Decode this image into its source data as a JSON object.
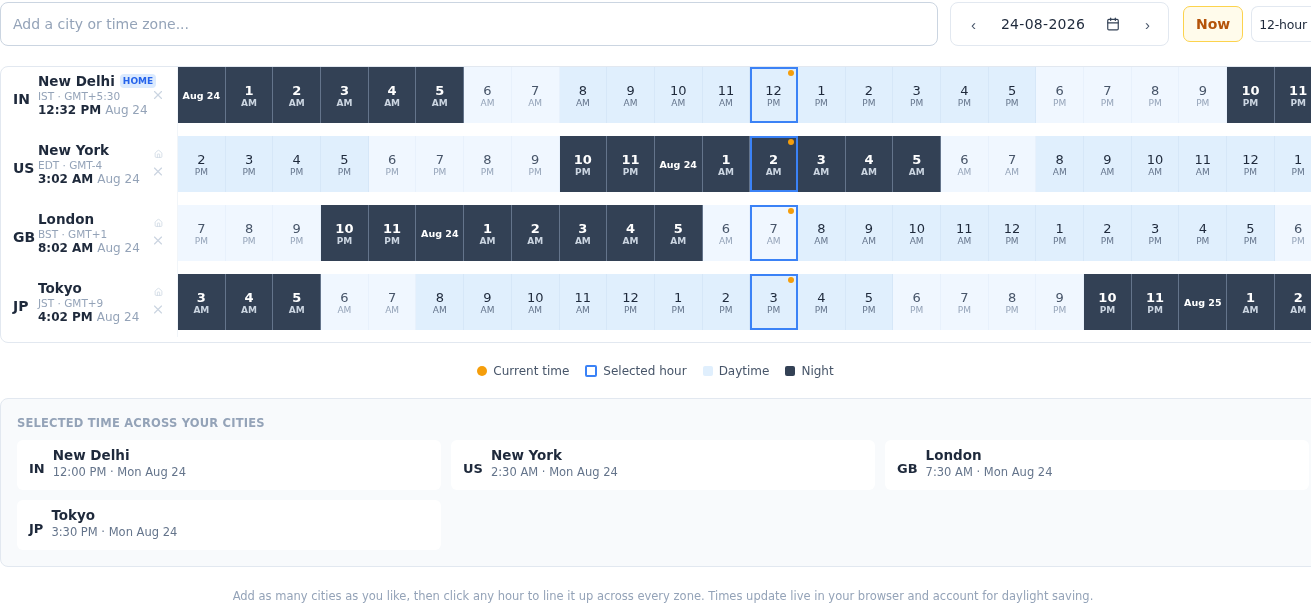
{
  "search": {
    "placeholder": "Add a city or time zone..."
  },
  "date_nav": {
    "prev": "‹",
    "date": "24-08-2026",
    "next": "›"
  },
  "now_button": "Now",
  "format_toggle": "12-hour",
  "rows": [
    {
      "code": "IN",
      "city": "New Delhi",
      "home": true,
      "badge": "HOME",
      "zone": "IST · GMT+5:30",
      "time": "12:32 PM",
      "date": "Aug 24",
      "cells": [
        {
          "date": "Aug 24",
          "kind": "night",
          "selected": false,
          "current": false
        },
        {
          "hour": "1",
          "period": "AM",
          "kind": "night",
          "selected": false,
          "current": false
        },
        {
          "hour": "2",
          "period": "AM",
          "kind": "night",
          "selected": false,
          "current": false
        },
        {
          "hour": "3",
          "period": "AM",
          "kind": "night",
          "selected": false,
          "current": false
        },
        {
          "hour": "4",
          "period": "AM",
          "kind": "night",
          "selected": false,
          "current": false
        },
        {
          "hour": "5",
          "period": "AM",
          "kind": "night",
          "selected": false,
          "current": false
        },
        {
          "hour": "6",
          "period": "AM",
          "kind": "dim",
          "selected": false,
          "current": false
        },
        {
          "hour": "7",
          "period": "AM",
          "kind": "dim",
          "selected": false,
          "current": false
        },
        {
          "hour": "8",
          "period": "AM",
          "kind": "day",
          "selected": false,
          "current": false
        },
        {
          "hour": "9",
          "period": "AM",
          "kind": "day",
          "selected": false,
          "current": false
        },
        {
          "hour": "10",
          "period": "AM",
          "kind": "day",
          "selected": false,
          "current": false
        },
        {
          "hour": "11",
          "period": "AM",
          "kind": "day",
          "selected": false,
          "current": false
        },
        {
          "hour": "12",
          "period": "PM",
          "kind": "day",
          "selected": true,
          "current": true
        },
        {
          "hour": "1",
          "period": "PM",
          "kind": "day",
          "selected": false,
          "current": false
        },
        {
          "hour": "2",
          "period": "PM",
          "kind": "day",
          "selected": false,
          "current": false
        },
        {
          "hour": "3",
          "period": "PM",
          "kind": "day",
          "selected": false,
          "current": false
        },
        {
          "hour": "4",
          "period": "PM",
          "kind": "day",
          "selected": false,
          "current": false
        },
        {
          "hour": "5",
          "period": "PM",
          "kind": "day",
          "selected": false,
          "current": false
        },
        {
          "hour": "6",
          "period": "PM",
          "kind": "dim",
          "selected": false,
          "current": false
        },
        {
          "hour": "7",
          "period": "PM",
          "kind": "dim",
          "selected": false,
          "current": false
        },
        {
          "hour": "8",
          "period": "PM",
          "kind": "dim",
          "selected": false,
          "current": false
        },
        {
          "hour": "9",
          "period": "PM",
          "kind": "dim",
          "selected": false,
          "current": false
        },
        {
          "hour": "10",
          "period": "PM",
          "kind": "night",
          "selected": false,
          "current": false
        },
        {
          "hour": "11",
          "period": "PM",
          "kind": "night",
          "selected": false,
          "current": false
        }
      ]
    },
    {
      "code": "US",
      "city": "New York",
      "home": false,
      "zone": "EDT · GMT-4",
      "time": "3:02 AM",
      "date": "Aug 24",
      "cells": [
        {
          "hour": "2",
          "period": "PM",
          "kind": "day",
          "selected": false,
          "current": false
        },
        {
          "hour": "3",
          "period": "PM",
          "kind": "day",
          "selected": false,
          "current": false
        },
        {
          "hour": "4",
          "period": "PM",
          "kind": "day",
          "selected": false,
          "current": false
        },
        {
          "hour": "5",
          "period": "PM",
          "kind": "day",
          "selected": false,
          "current": false
        },
        {
          "hour": "6",
          "period": "PM",
          "kind": "dim",
          "selected": false,
          "current": false
        },
        {
          "hour": "7",
          "period": "PM",
          "kind": "dim",
          "selected": false,
          "current": false
        },
        {
          "hour": "8",
          "period": "PM",
          "kind": "dim",
          "selected": false,
          "current": false
        },
        {
          "hour": "9",
          "period": "PM",
          "kind": "dim",
          "selected": false,
          "current": false
        },
        {
          "hour": "10",
          "period": "PM",
          "kind": "night",
          "selected": false,
          "current": false
        },
        {
          "hour": "11",
          "period": "PM",
          "kind": "night",
          "selected": false,
          "current": false
        },
        {
          "date": "Aug 24",
          "kind": "night",
          "selected": false,
          "current": false
        },
        {
          "hour": "1",
          "period": "AM",
          "kind": "night",
          "selected": false,
          "current": false
        },
        {
          "hour": "2",
          "period": "AM",
          "kind": "night",
          "selected": true,
          "current": true
        },
        {
          "hour": "3",
          "period": "AM",
          "kind": "night",
          "selected": false,
          "current": false
        },
        {
          "hour": "4",
          "period": "AM",
          "kind": "night",
          "selected": false,
          "current": false
        },
        {
          "hour": "5",
          "period": "AM",
          "kind": "night",
          "selected": false,
          "current": false
        },
        {
          "hour": "6",
          "period": "AM",
          "kind": "dim",
          "selected": false,
          "current": false
        },
        {
          "hour": "7",
          "period": "AM",
          "kind": "dim",
          "selected": false,
          "current": false
        },
        {
          "hour": "8",
          "period": "AM",
          "kind": "day",
          "selected": false,
          "current": false
        },
        {
          "hour": "9",
          "period": "AM",
          "kind": "day",
          "selected": false,
          "current": false
        },
        {
          "hour": "10",
          "period": "AM",
          "kind": "day",
          "selected": false,
          "current": false
        },
        {
          "hour": "11",
          "period": "AM",
          "kind": "day",
          "selected": false,
          "current": false
        },
        {
          "hour": "12",
          "period": "PM",
          "kind": "day",
          "selected": false,
          "current": false
        },
        {
          "hour": "1",
          "period": "PM",
          "kind": "day",
          "selected": false,
          "current": false
        }
      ]
    },
    {
      "code": "GB",
      "city": "London",
      "home": false,
      "zone": "BST · GMT+1",
      "time": "8:02 AM",
      "date": "Aug 24",
      "cells": [
        {
          "hour": "7",
          "period": "PM",
          "kind": "dim",
          "selected": false,
          "current": false
        },
        {
          "hour": "8",
          "period": "PM",
          "kind": "dim",
          "selected": false,
          "current": false
        },
        {
          "hour": "9",
          "period": "PM",
          "kind": "dim",
          "selected": false,
          "current": false
        },
        {
          "hour": "10",
          "period": "PM",
          "kind": "night",
          "selected": false,
          "current": false
        },
        {
          "hour": "11",
          "period": "PM",
          "kind": "night",
          "selected": false,
          "current": false
        },
        {
          "date": "Aug 24",
          "kind": "night",
          "selected": false,
          "current": false
        },
        {
          "hour": "1",
          "period": "AM",
          "kind": "night",
          "selected": false,
          "current": false
        },
        {
          "hour": "2",
          "period": "AM",
          "kind": "night",
          "selected": false,
          "current": false
        },
        {
          "hour": "3",
          "period": "AM",
          "kind": "night",
          "selected": false,
          "current": false
        },
        {
          "hour": "4",
          "period": "AM",
          "kind": "night",
          "selected": false,
          "current": false
        },
        {
          "hour": "5",
          "period": "AM",
          "kind": "night",
          "selected": false,
          "current": false
        },
        {
          "hour": "6",
          "period": "AM",
          "kind": "dim",
          "selected": false,
          "current": false
        },
        {
          "hour": "7",
          "period": "AM",
          "kind": "dim",
          "selected": true,
          "current": true
        },
        {
          "hour": "8",
          "period": "AM",
          "kind": "day",
          "selected": false,
          "current": false
        },
        {
          "hour": "9",
          "period": "AM",
          "kind": "day",
          "selected": false,
          "current": false
        },
        {
          "hour": "10",
          "period": "AM",
          "kind": "day",
          "selected": false,
          "current": false
        },
        {
          "hour": "11",
          "period": "AM",
          "kind": "day",
          "selected": false,
          "current": false
        },
        {
          "hour": "12",
          "period": "PM",
          "kind": "day",
          "selected": false,
          "current": false
        },
        {
          "hour": "1",
          "period": "PM",
          "kind": "day",
          "selected": false,
          "current": false
        },
        {
          "hour": "2",
          "period": "PM",
          "kind": "day",
          "selected": false,
          "current": false
        },
        {
          "hour": "3",
          "period": "PM",
          "kind": "day",
          "selected": false,
          "current": false
        },
        {
          "hour": "4",
          "period": "PM",
          "kind": "day",
          "selected": false,
          "current": false
        },
        {
          "hour": "5",
          "period": "PM",
          "kind": "day",
          "selected": false,
          "current": false
        },
        {
          "hour": "6",
          "period": "PM",
          "kind": "dim",
          "selected": false,
          "current": false
        }
      ]
    },
    {
      "code": "JP",
      "city": "Tokyo",
      "home": false,
      "zone": "JST · GMT+9",
      "time": "4:02 PM",
      "date": "Aug 24",
      "cells": [
        {
          "hour": "3",
          "period": "AM",
          "kind": "night",
          "selected": false,
          "current": false
        },
        {
          "hour": "4",
          "period": "AM",
          "kind": "night",
          "selected": false,
          "current": false
        },
        {
          "hour": "5",
          "period": "AM",
          "kind": "night",
          "selected": false,
          "current": false
        },
        {
          "hour": "6",
          "period": "AM",
          "kind": "dim",
          "selected": false,
          "current": false
        },
        {
          "hour": "7",
          "period": "AM",
          "kind": "dim",
          "selected": false,
          "current": false
        },
        {
          "hour": "8",
          "period": "AM",
          "kind": "day",
          "selected": false,
          "current": false
        },
        {
          "hour": "9",
          "period": "AM",
          "kind": "day",
          "selected": false,
          "current": false
        },
        {
          "hour": "10",
          "period": "AM",
          "kind": "day",
          "selected": false,
          "current": false
        },
        {
          "hour": "11",
          "period": "AM",
          "kind": "day",
          "selected": false,
          "current": false
        },
        {
          "hour": "12",
          "period": "PM",
          "kind": "day",
          "selected": false,
          "current": false
        },
        {
          "hour": "1",
          "period": "PM",
          "kind": "day",
          "selected": false,
          "current": false
        },
        {
          "hour": "2",
          "period": "PM",
          "kind": "day",
          "selected": false,
          "current": false
        },
        {
          "hour": "3",
          "period": "PM",
          "kind": "day",
          "selected": true,
          "current": true
        },
        {
          "hour": "4",
          "period": "PM",
          "kind": "day",
          "selected": false,
          "current": false
        },
        {
          "hour": "5",
          "period": "PM",
          "kind": "day",
          "selected": false,
          "current": false
        },
        {
          "hour": "6",
          "period": "PM",
          "kind": "dim",
          "selected": false,
          "current": false
        },
        {
          "hour": "7",
          "period": "PM",
          "kind": "dim",
          "selected": false,
          "current": false
        },
        {
          "hour": "8",
          "period": "PM",
          "kind": "dim",
          "selected": false,
          "current": false
        },
        {
          "hour": "9",
          "period": "PM",
          "kind": "dim",
          "selected": false,
          "current": false
        },
        {
          "hour": "10",
          "period": "PM",
          "kind": "night",
          "selected": false,
          "current": false
        },
        {
          "hour": "11",
          "period": "PM",
          "kind": "night",
          "selected": false,
          "current": false
        },
        {
          "date": "Aug 25",
          "kind": "night",
          "selected": false,
          "current": false
        },
        {
          "hour": "1",
          "period": "AM",
          "kind": "night",
          "selected": false,
          "current": false
        },
        {
          "hour": "2",
          "period": "AM",
          "kind": "night",
          "selected": false,
          "current": false
        }
      ]
    }
  ],
  "legend": [
    {
      "kind": "current",
      "label": "Current time"
    },
    {
      "kind": "selected",
      "label": "Selected hour"
    },
    {
      "kind": "day",
      "label": "Daytime"
    },
    {
      "kind": "night",
      "label": "Night"
    }
  ],
  "summary": {
    "title": "SELECTED TIME ACROSS YOUR CITIES",
    "cities": [
      {
        "code": "IN",
        "city": "New Delhi",
        "time": "12:00 PM · Mon Aug 24"
      },
      {
        "code": "US",
        "city": "New York",
        "time": "2:30 AM · Mon Aug 24"
      },
      {
        "code": "GB",
        "city": "London",
        "time": "7:30 AM · Mon Aug 24"
      },
      {
        "code": "JP",
        "city": "Tokyo",
        "time": "3:30 PM · Mon Aug 24"
      }
    ]
  },
  "footer": "Add as many cities as you like, then click any hour to line it up across every zone. Times update live in your browser and account for daylight saving."
}
